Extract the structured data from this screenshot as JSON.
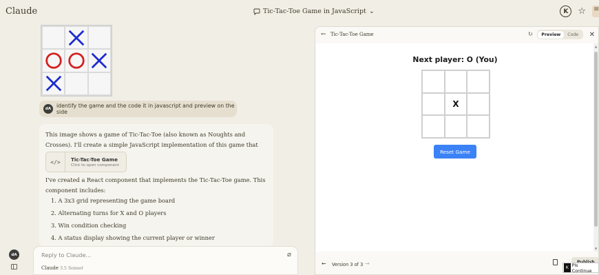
{
  "app": {
    "brand": "Claude",
    "conversation_title": "Tic-Tac-Toe Game in JavaScript",
    "user_initial": "K"
  },
  "image_board": {
    "cells": [
      "",
      "X",
      "",
      "O",
      "O",
      "X",
      "X",
      "",
      ""
    ]
  },
  "user_message": {
    "avatar": "dA",
    "text": "identify the game and the code it in javascript and preview on the side"
  },
  "assistant_message": {
    "intro": "This image shows a game of Tic-Tac-Toe (also known as Noughts and Crosses). I'll create a simple JavaScript implementation of this game that can be previewed.",
    "artifact": {
      "icon": "</>",
      "name": "Tic-Tac-Toe Game",
      "subtitle": "Click to open component"
    },
    "body": "I've created a React component that implements the Tic-Tac-Toe game. This component includes:",
    "list": [
      "1. A 3x3 grid representing the game board",
      "2. Alternating turns for X and O players",
      "3. Win condition checking",
      "4. A status display showing the current player or winner"
    ]
  },
  "composer": {
    "placeholder": "Reply to Claude...",
    "model": "Claude",
    "model_version": "3.5 Sonnet",
    "avatar": "dA"
  },
  "artifact_panel": {
    "title": "Tic-Tac-Toe Game",
    "tabs": [
      "Preview",
      "Code"
    ],
    "active_tab": "Preview",
    "preview": {
      "status": "Next player: O (You)",
      "cells": [
        "",
        "",
        "",
        "",
        "X",
        "",
        "",
        "",
        ""
      ],
      "reset_label": "Reset Game",
      "button_color": "#3b82f6"
    },
    "footer": {
      "version": "Version 3 of 3",
      "publish": "Publish"
    }
  },
  "tooltip": {
    "key": "K",
    "text": "Pls Continue"
  }
}
